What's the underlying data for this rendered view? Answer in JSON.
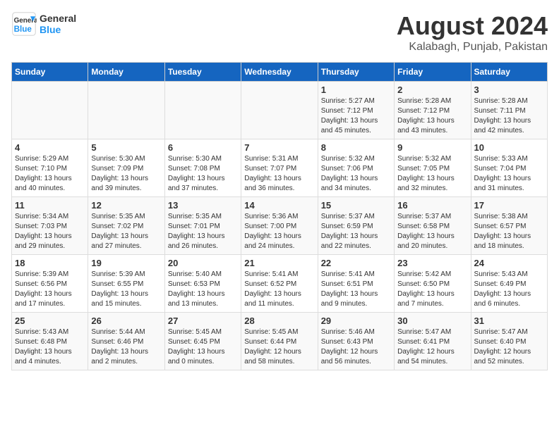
{
  "header": {
    "logo_line1": "General",
    "logo_line2": "Blue",
    "month_year": "August 2024",
    "location": "Kalabagh, Punjab, Pakistan"
  },
  "days_of_week": [
    "Sunday",
    "Monday",
    "Tuesday",
    "Wednesday",
    "Thursday",
    "Friday",
    "Saturday"
  ],
  "weeks": [
    [
      {
        "day": "",
        "content": ""
      },
      {
        "day": "",
        "content": ""
      },
      {
        "day": "",
        "content": ""
      },
      {
        "day": "",
        "content": ""
      },
      {
        "day": "1",
        "content": "Sunrise: 5:27 AM\nSunset: 7:12 PM\nDaylight: 13 hours\nand 45 minutes."
      },
      {
        "day": "2",
        "content": "Sunrise: 5:28 AM\nSunset: 7:12 PM\nDaylight: 13 hours\nand 43 minutes."
      },
      {
        "day": "3",
        "content": "Sunrise: 5:28 AM\nSunset: 7:11 PM\nDaylight: 13 hours\nand 42 minutes."
      }
    ],
    [
      {
        "day": "4",
        "content": "Sunrise: 5:29 AM\nSunset: 7:10 PM\nDaylight: 13 hours\nand 40 minutes."
      },
      {
        "day": "5",
        "content": "Sunrise: 5:30 AM\nSunset: 7:09 PM\nDaylight: 13 hours\nand 39 minutes."
      },
      {
        "day": "6",
        "content": "Sunrise: 5:30 AM\nSunset: 7:08 PM\nDaylight: 13 hours\nand 37 minutes."
      },
      {
        "day": "7",
        "content": "Sunrise: 5:31 AM\nSunset: 7:07 PM\nDaylight: 13 hours\nand 36 minutes."
      },
      {
        "day": "8",
        "content": "Sunrise: 5:32 AM\nSunset: 7:06 PM\nDaylight: 13 hours\nand 34 minutes."
      },
      {
        "day": "9",
        "content": "Sunrise: 5:32 AM\nSunset: 7:05 PM\nDaylight: 13 hours\nand 32 minutes."
      },
      {
        "day": "10",
        "content": "Sunrise: 5:33 AM\nSunset: 7:04 PM\nDaylight: 13 hours\nand 31 minutes."
      }
    ],
    [
      {
        "day": "11",
        "content": "Sunrise: 5:34 AM\nSunset: 7:03 PM\nDaylight: 13 hours\nand 29 minutes."
      },
      {
        "day": "12",
        "content": "Sunrise: 5:35 AM\nSunset: 7:02 PM\nDaylight: 13 hours\nand 27 minutes."
      },
      {
        "day": "13",
        "content": "Sunrise: 5:35 AM\nSunset: 7:01 PM\nDaylight: 13 hours\nand 26 minutes."
      },
      {
        "day": "14",
        "content": "Sunrise: 5:36 AM\nSunset: 7:00 PM\nDaylight: 13 hours\nand 24 minutes."
      },
      {
        "day": "15",
        "content": "Sunrise: 5:37 AM\nSunset: 6:59 PM\nDaylight: 13 hours\nand 22 minutes."
      },
      {
        "day": "16",
        "content": "Sunrise: 5:37 AM\nSunset: 6:58 PM\nDaylight: 13 hours\nand 20 minutes."
      },
      {
        "day": "17",
        "content": "Sunrise: 5:38 AM\nSunset: 6:57 PM\nDaylight: 13 hours\nand 18 minutes."
      }
    ],
    [
      {
        "day": "18",
        "content": "Sunrise: 5:39 AM\nSunset: 6:56 PM\nDaylight: 13 hours\nand 17 minutes."
      },
      {
        "day": "19",
        "content": "Sunrise: 5:39 AM\nSunset: 6:55 PM\nDaylight: 13 hours\nand 15 minutes."
      },
      {
        "day": "20",
        "content": "Sunrise: 5:40 AM\nSunset: 6:53 PM\nDaylight: 13 hours\nand 13 minutes."
      },
      {
        "day": "21",
        "content": "Sunrise: 5:41 AM\nSunset: 6:52 PM\nDaylight: 13 hours\nand 11 minutes."
      },
      {
        "day": "22",
        "content": "Sunrise: 5:41 AM\nSunset: 6:51 PM\nDaylight: 13 hours\nand 9 minutes."
      },
      {
        "day": "23",
        "content": "Sunrise: 5:42 AM\nSunset: 6:50 PM\nDaylight: 13 hours\nand 7 minutes."
      },
      {
        "day": "24",
        "content": "Sunrise: 5:43 AM\nSunset: 6:49 PM\nDaylight: 13 hours\nand 6 minutes."
      }
    ],
    [
      {
        "day": "25",
        "content": "Sunrise: 5:43 AM\nSunset: 6:48 PM\nDaylight: 13 hours\nand 4 minutes."
      },
      {
        "day": "26",
        "content": "Sunrise: 5:44 AM\nSunset: 6:46 PM\nDaylight: 13 hours\nand 2 minutes."
      },
      {
        "day": "27",
        "content": "Sunrise: 5:45 AM\nSunset: 6:45 PM\nDaylight: 13 hours\nand 0 minutes."
      },
      {
        "day": "28",
        "content": "Sunrise: 5:45 AM\nSunset: 6:44 PM\nDaylight: 12 hours\nand 58 minutes."
      },
      {
        "day": "29",
        "content": "Sunrise: 5:46 AM\nSunset: 6:43 PM\nDaylight: 12 hours\nand 56 minutes."
      },
      {
        "day": "30",
        "content": "Sunrise: 5:47 AM\nSunset: 6:41 PM\nDaylight: 12 hours\nand 54 minutes."
      },
      {
        "day": "31",
        "content": "Sunrise: 5:47 AM\nSunset: 6:40 PM\nDaylight: 12 hours\nand 52 minutes."
      }
    ]
  ]
}
